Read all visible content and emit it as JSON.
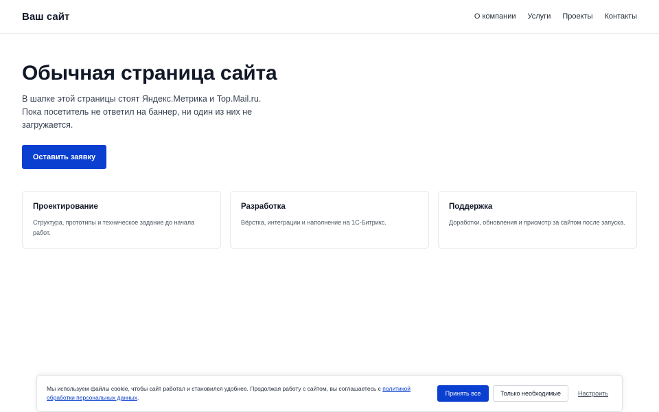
{
  "header": {
    "logo": "Ваш сайт",
    "nav": [
      "О компании",
      "Услуги",
      "Проекты",
      "Контакты"
    ]
  },
  "hero": {
    "title": "Обычная страница сайта",
    "text": "В шапке этой страницы стоят Яндекс.Метрика и Top.Mail.ru. Пока посетитель не ответил на баннер, ни один из них не загружается.",
    "cta_label": "Оставить заявку"
  },
  "cards": [
    {
      "title": "Проектирование",
      "text": "Структура, прототипы и техническое задание до начала работ."
    },
    {
      "title": "Разработка",
      "text": "Вёрстка, интеграции и наполнение на 1С-Битрикс."
    },
    {
      "title": "Поддержка",
      "text": "Доработки, обновления и присмотр за сайтом после запуска."
    }
  ],
  "cookie_banner": {
    "text": "Мы используем файлы cookie, чтобы сайт работал и становился удобнее. Продолжая работу с сайтом, вы соглашаетесь с",
    "link_text": "политикой обработки персональных данных",
    "text_end": ".",
    "accept_label": "Принять все",
    "essential_label": "Только необходимые",
    "settings_label": "Настроить"
  },
  "colors": {
    "accent": "#0a3fcf",
    "text": "#111827",
    "border": "#e6e8ec"
  }
}
